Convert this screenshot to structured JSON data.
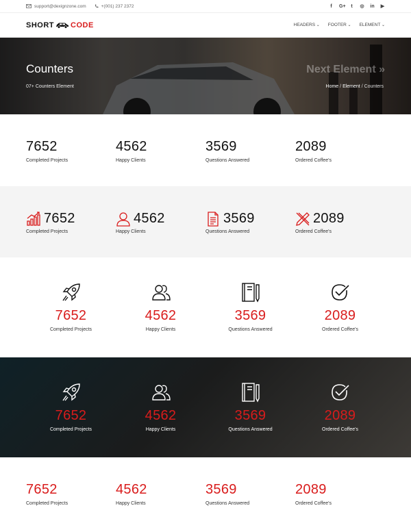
{
  "topbar": {
    "email": "support@dexignzone.com",
    "phone": "+(001) 237 2372",
    "socials": [
      "f",
      "G+",
      "t",
      "◎",
      "in",
      "▶"
    ]
  },
  "logo": {
    "part1": "SHORT",
    "part2": "CODE"
  },
  "menu": [
    "HEADERS",
    "FOOTER",
    "ELEMENT"
  ],
  "banner": {
    "title": "Counters",
    "subtitle": "07+ Counters Element",
    "next": "Next Element »",
    "breadcrumb": [
      "Home",
      "Element",
      "Counters"
    ]
  },
  "counters": [
    {
      "value": "7652",
      "label": "Completed Projects",
      "icon": "chart-icon",
      "icon2": "rocket-icon"
    },
    {
      "value": "4562",
      "label": "Happy Clients",
      "icon": "user-icon",
      "icon2": "users-icon"
    },
    {
      "value": "3569",
      "label": "Questions Answered",
      "icon": "document-icon",
      "icon2": "notebook-icon"
    },
    {
      "value": "2089",
      "label": "Ordered Coffee's",
      "icon": "pencil-ruler-icon",
      "icon2": "check-badge-icon"
    }
  ],
  "colors": {
    "accent": "#d91c1c"
  }
}
